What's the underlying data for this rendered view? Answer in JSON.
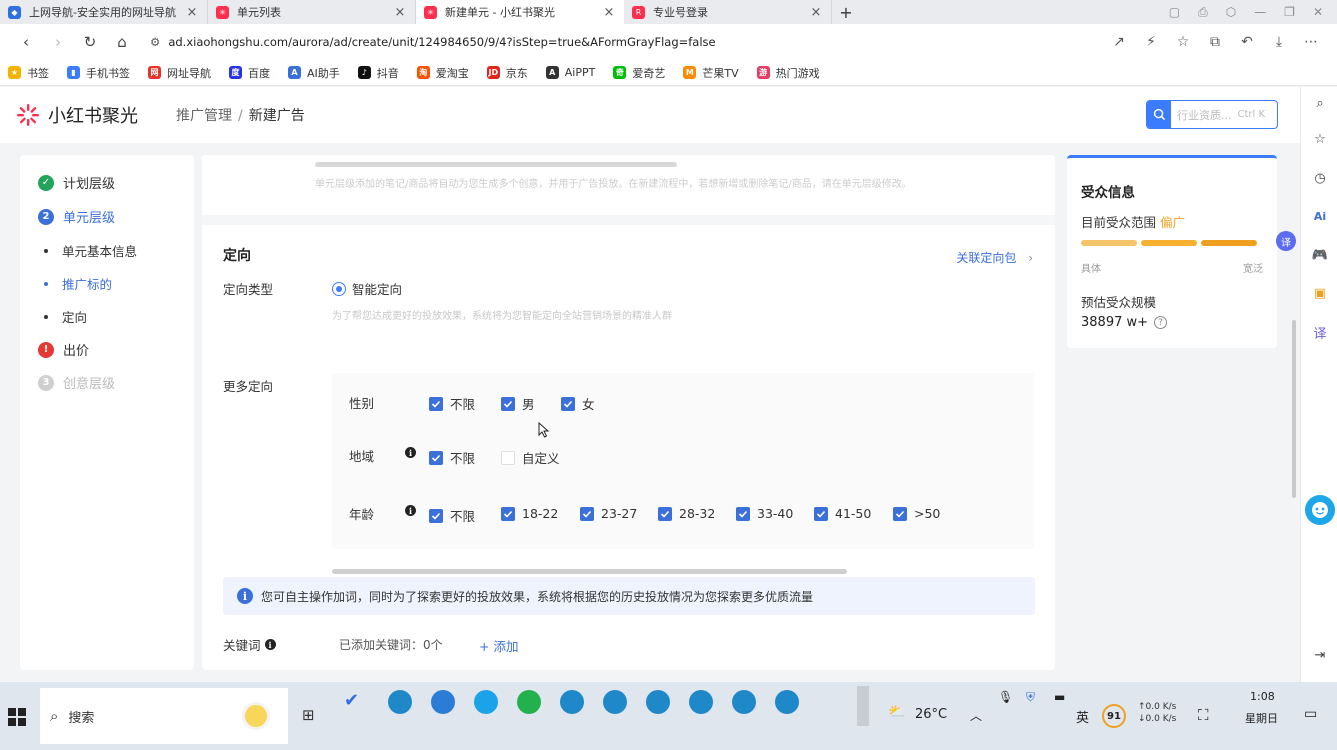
{
  "browser": {
    "tabs": [
      {
        "title": "上网导航-安全实用的网址导航",
        "fav_color": "#2f6fe4",
        "active": false
      },
      {
        "title": "单元列表",
        "fav_color": "#ff2e4d",
        "active": false
      },
      {
        "title": "新建单元 - 小红书聚光",
        "fav_color": "#ff2e4d",
        "active": true
      },
      {
        "title": "专业号登录",
        "fav_color": "#ff2e4d",
        "active": false
      }
    ],
    "new_tab": "+",
    "url": "ad.xiaohongshu.com/aurora/ad/create/unit/124984650/9/4?isStep=true&AFormGrayFlag=false",
    "bookmarks": [
      {
        "label": "书签",
        "color": "#f5b400",
        "glyph": "★"
      },
      {
        "label": "手机书签",
        "color": "#3b7cff",
        "glyph": "▮"
      },
      {
        "label": "网址导航",
        "color": "#e8332a",
        "glyph": "网"
      },
      {
        "label": "百度",
        "color": "#2932e1",
        "glyph": "度"
      },
      {
        "label": "AI助手",
        "color": "#3b6fd9",
        "glyph": "A"
      },
      {
        "label": "抖音",
        "color": "#111111",
        "glyph": "♪"
      },
      {
        "label": "爱淘宝",
        "color": "#ff5000",
        "glyph": "淘"
      },
      {
        "label": "京东",
        "color": "#e1251b",
        "glyph": "JD"
      },
      {
        "label": "AiPPT",
        "color": "#333333",
        "glyph": "A"
      },
      {
        "label": "爱奇艺",
        "color": "#00be06",
        "glyph": "奇"
      },
      {
        "label": "芒果TV",
        "color": "#ff8a00",
        "glyph": "M"
      },
      {
        "label": "热门游戏",
        "color": "#e83a66",
        "glyph": "游"
      }
    ]
  },
  "app": {
    "name": "小红书聚光",
    "breadcrumb": [
      "推广管理",
      "新建广告"
    ],
    "search_placeholder": "行业资质...",
    "search_shortcut": "Ctrl K"
  },
  "steps": [
    {
      "label": "计划层级",
      "state": "done",
      "badge": "✓",
      "color": "#22a45a"
    },
    {
      "label": "单元层级",
      "state": "current",
      "badge": "2",
      "color": "#3b6fd9"
    },
    {
      "label": "出价",
      "state": "error",
      "badge": "!",
      "color": "#e53935"
    },
    {
      "label": "创意层级",
      "state": "todo",
      "badge": "3",
      "color": "#cfcfcf"
    }
  ],
  "substeps": [
    {
      "label": "单元基本信息",
      "active": false
    },
    {
      "label": "推广标的",
      "active": true
    },
    {
      "label": "定向",
      "active": false
    }
  ],
  "main": {
    "top_note": "单元层级添加的笔记/商品将自动为您生成多个创意，并用于广告投放。在新建流程中，若想新增或删除笔记/商品，请在单元层级修改。",
    "section_title": "定向",
    "link_label": "关联定向包",
    "targeting_type_label": "定向类型",
    "targeting_type_value": "智能定向",
    "targeting_hint": "为了帮您达成更好的投放效果，系统将为您智能定向全站营销场景的精准人群",
    "more_targeting_label": "更多定向",
    "gender": {
      "label": "性别",
      "options": [
        {
          "label": "不限",
          "checked": true
        },
        {
          "label": "男",
          "checked": true
        },
        {
          "label": "女",
          "checked": true
        }
      ]
    },
    "region": {
      "label": "地域",
      "options": [
        {
          "label": "不限",
          "checked": true
        },
        {
          "label": "自定义",
          "checked": false
        }
      ]
    },
    "age": {
      "label": "年龄",
      "options": [
        {
          "label": "不限",
          "checked": true
        },
        {
          "label": "18-22",
          "checked": true
        },
        {
          "label": "23-27",
          "checked": true
        },
        {
          "label": "28-32",
          "checked": true
        },
        {
          "label": "33-40",
          "checked": true
        },
        {
          "label": "41-50",
          "checked": true
        },
        {
          "label": ">50",
          "checked": true
        }
      ]
    },
    "alert_text": "您可自主操作加词，同时为了探索更好的投放效果，系统将根据您的历史投放情况为您探索更多优质流量",
    "keywords_label": "关键词",
    "keywords_count": "已添加关键词：0个",
    "keywords_add": "+ 添加"
  },
  "audience": {
    "title": "受众信息",
    "range_label": "目前受众范围",
    "range_tag": "偏广",
    "scale_low": "具体",
    "scale_high": "宽泛",
    "size_label": "预估受众规模",
    "size_value": "38897 w+",
    "bar_colors": [
      "#f5c46a",
      "#f5b030",
      "#f0a020"
    ]
  },
  "taskbar": {
    "search": "搜索",
    "weather": "26°C",
    "ime": "英",
    "battery": "91",
    "net_up": "0.0 K/s",
    "net_down": "0.0 K/s",
    "time": "1:08",
    "weekday": "星期日"
  }
}
